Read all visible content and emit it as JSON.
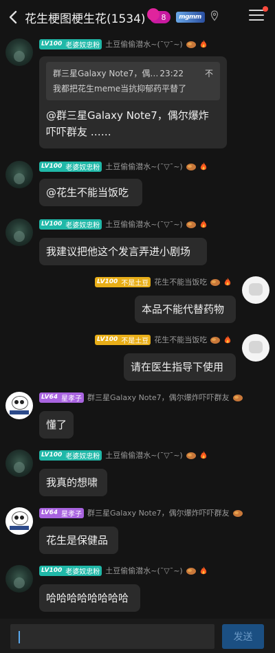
{
  "header": {
    "title": "花生梗图梗生花(1534)",
    "badge_count": "8",
    "logo_badge": "mgmm"
  },
  "messages": [
    {
      "sender": "left",
      "avatar": "dark-character-avatar",
      "level_no": "LV100",
      "level_title": "老婆奴忠粉",
      "nickname": "土豆偷偷潜水~(¯▽¯~)",
      "quote": {
        "title": "群三星Galaxy Note7，偶…",
        "time": "23:22",
        "close": "不",
        "text": "我都把花生meme当抗抑郁药平替了"
      },
      "lines": [
        "@群三星Galaxy Note7，偶尔爆炸",
        "吓吓群友 ……"
      ]
    },
    {
      "sender": "left",
      "avatar": "dark-character-avatar",
      "level_no": "LV100",
      "level_title": "老婆奴忠粉",
      "nickname": "土豆偷偷潜水~(¯▽¯~)",
      "text": "@花生不能当饭吃"
    },
    {
      "sender": "left",
      "avatar": "dark-character-avatar",
      "level_no": "LV100",
      "level_title": "老婆奴忠粉",
      "nickname": "土豆偷偷潜水~(¯▽¯~)",
      "text": "我建议把他这个发言弄进小剧场"
    },
    {
      "sender": "right",
      "avatar": "white-character-avatar",
      "level_no": "LV100",
      "level_title": "不是土豆",
      "nickname": "花生不能当饭吃",
      "text": "本品不能代替药物"
    },
    {
      "sender": "right",
      "avatar": "white-character-avatar",
      "level_no": "LV100",
      "level_title": "不是土豆",
      "nickname": "花生不能当饭吃",
      "text": "请在医生指导下使用"
    },
    {
      "sender": "left",
      "avatar": "panda-avatar",
      "level_no": "LV64",
      "level_title": "星孝子",
      "nickname": "群三星Galaxy Note7，偶尔爆炸吓吓群友",
      "text": "懂了"
    },
    {
      "sender": "left",
      "avatar": "dark-character-avatar",
      "level_no": "LV100",
      "level_title": "老婆奴忠粉",
      "nickname": "土豆偷偷潜水~(¯▽¯~)",
      "text": "我真的想啸"
    },
    {
      "sender": "left",
      "avatar": "panda-avatar",
      "level_no": "LV64",
      "level_title": "星孝子",
      "nickname": "群三星Galaxy Note7，偶尔爆炸吓吓群友",
      "text": "花生是保健品"
    },
    {
      "sender": "left",
      "avatar": "dark-character-avatar",
      "level_no": "LV100",
      "level_title": "老婆奴忠粉",
      "nickname": "土豆偷偷潜水~(¯▽¯~)",
      "text": "哈哈哈哈哈哈哈哈"
    }
  ],
  "input": {
    "value": "",
    "send_label": "发送"
  },
  "colors": {
    "level_teal": "#20b8a8",
    "level_yellow": "#e8ae18",
    "level_purple": "#a964e0",
    "send_button": "#1b4f82",
    "bubble": "#2b2b2b"
  }
}
